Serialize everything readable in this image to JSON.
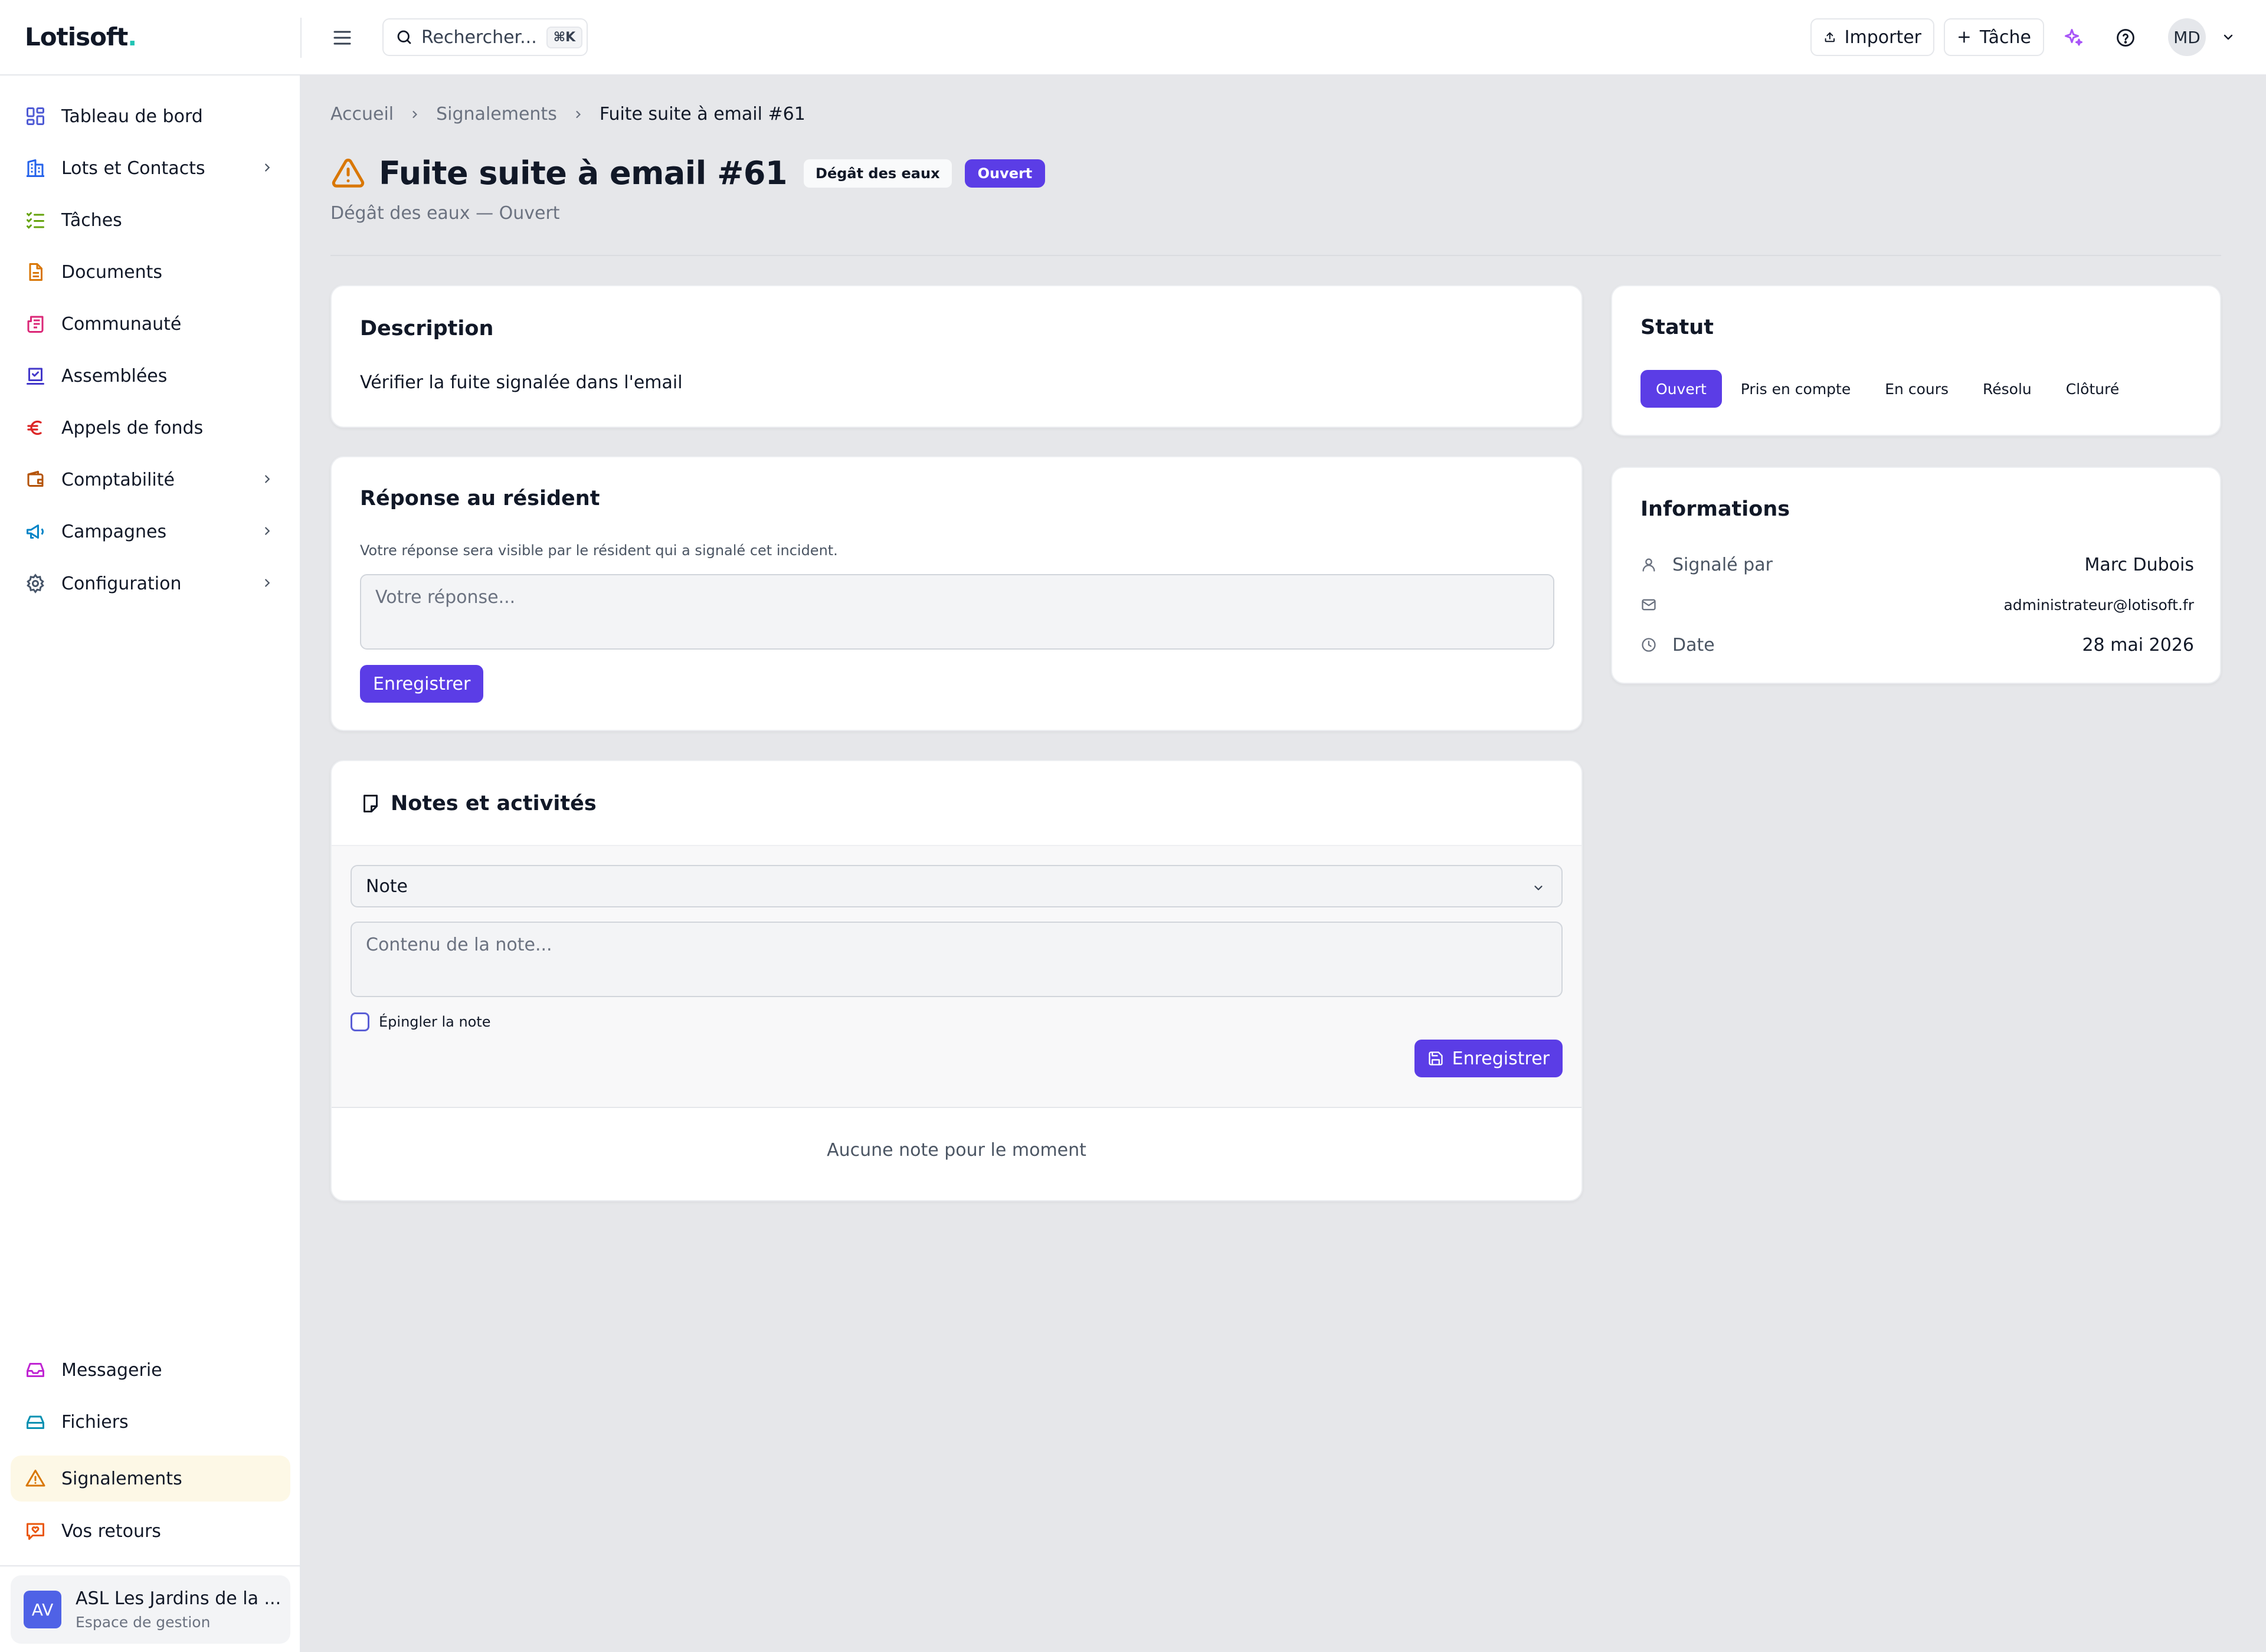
{
  "header": {
    "logo_text": "Lotisoft",
    "logo_dot": ".",
    "search_label": "Rechercher...",
    "search_shortcut": "⌘K",
    "import_label": "Importer",
    "task_label": "Tâche",
    "user_initials": "MD",
    "accent_color": "#22c4b4"
  },
  "sidebar": {
    "items": [
      {
        "label": "Tableau de bord",
        "icon": "dashboard-icon"
      },
      {
        "label": "Lots et Contacts",
        "icon": "building-icon",
        "has_submenu": true
      },
      {
        "label": "Tâches",
        "icon": "list-check-icon"
      },
      {
        "label": "Documents",
        "icon": "document-icon"
      },
      {
        "label": "Communauté",
        "icon": "newspaper-icon"
      },
      {
        "label": "Assemblées",
        "icon": "vote-icon"
      },
      {
        "label": "Appels de fonds",
        "icon": "euro-icon"
      },
      {
        "label": "Comptabilité",
        "icon": "wallet-icon",
        "has_submenu": true
      },
      {
        "label": "Campagnes",
        "icon": "megaphone-icon",
        "has_submenu": true
      },
      {
        "label": "Configuration",
        "icon": "gear-icon",
        "has_submenu": true
      }
    ],
    "bottom_items": [
      {
        "label": "Messagerie",
        "icon": "inbox-icon"
      },
      {
        "label": "Fichiers",
        "icon": "hard-drive-icon"
      },
      {
        "label": "Signalements",
        "icon": "warning-icon",
        "active": true
      },
      {
        "label": "Vos retours",
        "icon": "feedback-icon"
      }
    ],
    "org": {
      "initials": "AV",
      "name": "ASL Les Jardins de la ...",
      "subtitle": "Espace de gestion"
    }
  },
  "breadcrumb": [
    "Accueil",
    "Signalements",
    "Fuite suite à email #61"
  ],
  "page": {
    "title": "Fuite suite à email #61",
    "category_badge": "Dégât des eaux",
    "status_badge": "Ouvert",
    "subtitle": "Dégât des eaux — Ouvert",
    "status_color": "#5b3de6"
  },
  "description": {
    "title": "Description",
    "text": "Vérifier la fuite signalée dans l'email"
  },
  "reply": {
    "title": "Réponse au résident",
    "hint": "Votre réponse sera visible par le résident qui a signalé cet incident.",
    "placeholder": "Votre réponse...",
    "value": "",
    "save_label": "Enregistrer"
  },
  "notes": {
    "title": "Notes et activités",
    "type_value": "Note",
    "content_placeholder": "Contenu de la note...",
    "pin_label": "Épingler la note",
    "pin_checked": false,
    "save_label": "Enregistrer",
    "empty_text": "Aucune note pour le moment"
  },
  "status": {
    "title": "Statut",
    "options": [
      "Ouvert",
      "Pris en compte",
      "En cours",
      "Résolu",
      "Clôturé"
    ],
    "selected": "Ouvert"
  },
  "info": {
    "title": "Informations",
    "reported_by_label": "Signalé par",
    "reported_by_value": "Marc Dubois",
    "email_value": "administrateur@lotisoft.fr",
    "date_label": "Date",
    "date_value": "28 mai 2026"
  }
}
